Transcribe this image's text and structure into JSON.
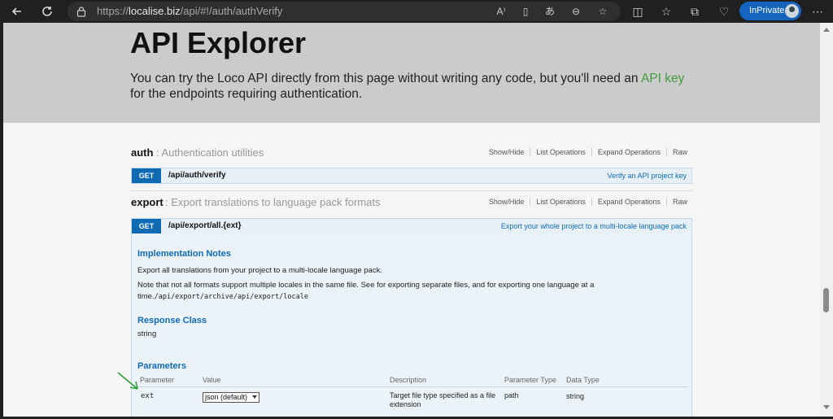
{
  "browser": {
    "url_prefix": "https://",
    "url_host": "localise.biz",
    "url_path": "/api/#!/auth/authVerify",
    "inprivate_label": "InPrivate"
  },
  "hero": {
    "title": "API Explorer",
    "intro_text": "You can try the Loco API directly from this page without writing any code, but you'll need an ",
    "api_key_link": "API key",
    "intro_tail": " for the endpoints requiring authentication."
  },
  "ops_labels": [
    "Show/Hide",
    "List Operations",
    "Expand Operations",
    "Raw"
  ],
  "sections": [
    {
      "name": "auth",
      "description": ": Authentication utilities",
      "operation": {
        "method": "GET",
        "path": "/api/auth/verify",
        "summary": "Verify an API project key"
      }
    },
    {
      "name": "export",
      "description": ": Export translations to language pack formats",
      "operation": {
        "method": "GET",
        "path": "/api/export/all.{ext}",
        "summary": "Export your whole project to a multi-locale language pack"
      }
    }
  ],
  "details": {
    "impl_title": "Implementation Notes",
    "impl_line1": "Export all translations from your project to a multi-locale language pack.",
    "impl_line2": "Note that not all formats support multiple locales in the same file. See for exporting separate files, and for exporting one language at a",
    "impl_line3_prefix": "time.",
    "impl_line3_code": "/api/export/archive/api/export/locale",
    "response_title": "Response Class",
    "response_value": "string",
    "params_title": "Parameters",
    "params_headers": [
      "Parameter",
      "Value",
      "Description",
      "Parameter Type",
      "Data Type"
    ],
    "param_row": {
      "name": "ext",
      "value": "json (default)",
      "description_line1": "Target file type specified as a file",
      "description_line2": "extension",
      "param_type": "path",
      "data_type": "string"
    }
  },
  "colors": {
    "accent": "#0f6ab4",
    "link_green": "#3f9d3f",
    "hero_bg": "#cbcbcb",
    "annotation_arrow": "#2e9e3a"
  }
}
